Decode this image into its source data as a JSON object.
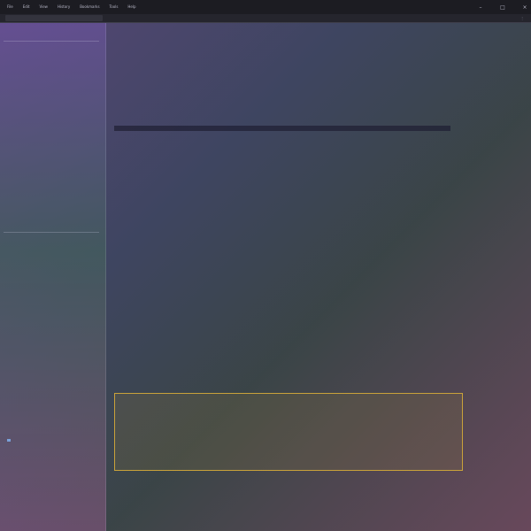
{
  "menubar": {
    "items": [
      "File",
      "Edit",
      "View",
      "History",
      "Bookmarks",
      "Tools",
      "Help"
    ],
    "minimize": "–",
    "maximize": "□",
    "close": "×"
  },
  "address": {
    "value": "",
    "right_text": "⋮"
  },
  "sidebar": {
    "title": "",
    "items": [
      "",
      "",
      "",
      "",
      "",
      "",
      "",
      "",
      "",
      "",
      "",
      "",
      "",
      "",
      "",
      "",
      "",
      "",
      "",
      "",
      ""
    ]
  },
  "main": {
    "heading_1": "",
    "lines_1": [
      "",
      "",
      "",
      ""
    ],
    "heading_2": "",
    "lines_2": [
      "",
      "",
      "",
      ""
    ],
    "heading_3": "",
    "lines_3": [
      "",
      "",
      ""
    ],
    "heading_4": "",
    "lines_4": [
      "",
      "",
      "",
      ""
    ],
    "heading_5": "",
    "lines_5": [
      "",
      "",
      ""
    ],
    "highlight_title": "",
    "highlight_lines": [
      "",
      "",
      "",
      ""
    ],
    "heading_6": "",
    "lines_6": [
      "",
      "",
      ""
    ],
    "heading_7": "",
    "lines_7": [
      "",
      "",
      "",
      ""
    ]
  }
}
